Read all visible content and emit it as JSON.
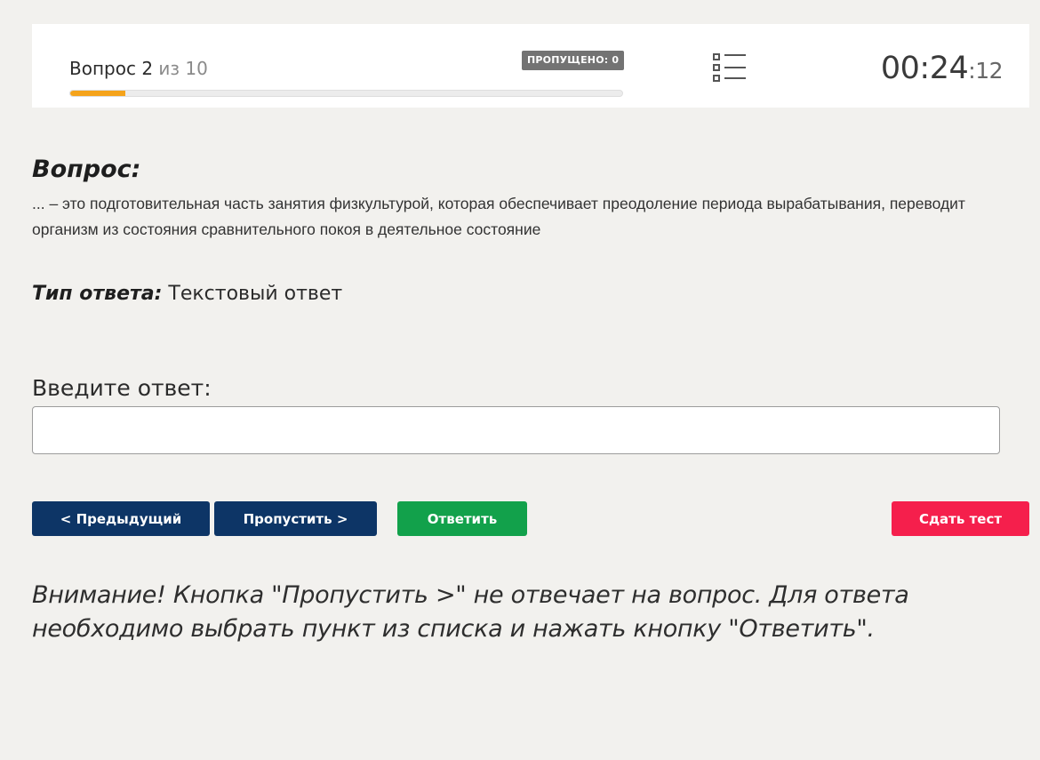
{
  "header": {
    "question_word": "Вопрос",
    "current": "2",
    "of_word": "из",
    "total": "10",
    "progress_fraction": 0.1,
    "skipped_label": "ПРОПУЩЕНО: 0",
    "list_icon": "question-list-icon",
    "timer": {
      "main": "00:24",
      "separator": ":",
      "seconds": "12"
    }
  },
  "question": {
    "title": "Вопрос:",
    "text": "... – это подготовительная часть занятия физкультурой, которая обеспечивает преодоление периода вырабатывания, переводит организм из состояния сравнительного покоя в деятельное состояние"
  },
  "answer_type": {
    "label": "Тип ответа:",
    "value": "Текстовый ответ"
  },
  "answer": {
    "label": "Введите ответ:",
    "value": "",
    "placeholder": ""
  },
  "buttons": {
    "prev": "< Предыдущий",
    "skip": "Пропустить >",
    "answer": "Ответить",
    "submit": "Сдать тест"
  },
  "warning": "Внимание! Кнопка \"Пропустить >\" не отвечает на вопрос. Для ответа необходимо выбрать пункт из списка и нажать кнопку \"Ответить\".",
  "colors": {
    "background": "#f2f1ee",
    "progress": "#f5a31a",
    "primary": "#0d3566",
    "success": "#12a14b",
    "danger": "#f51f4c",
    "badge": "#737373"
  }
}
